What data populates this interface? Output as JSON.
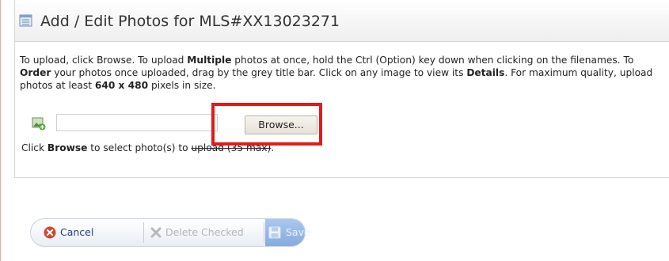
{
  "header": {
    "title": "Add / Edit Photos for MLS#XX13023271"
  },
  "instructions": {
    "p1": "To upload, click Browse. To upload ",
    "p1_bold": "Multiple",
    "p2": " photos at once, hold the Ctrl (Option) key down when clicking on the filenames. To ",
    "p2_bold": "Order",
    "p3": " your photos once uploaded, drag by the grey title bar. Click on any image to view its ",
    "p3_bold": "Details",
    "p4": ". For maximum quality, upload photos at least ",
    "p4_bold": "640 x 480",
    "p5": " pixels in size."
  },
  "upload": {
    "file_value": "",
    "browse_label": "Browse..."
  },
  "hint": {
    "pre": "Click ",
    "bold": "Browse",
    "mid": " to select photo(s) to ",
    "struck": "upload (35 max)",
    "post": "."
  },
  "toolbar": {
    "cancel_label": "Cancel",
    "delete_label": "Delete Checked",
    "save_label": "Save"
  },
  "icons": {
    "header": "photo-list-icon",
    "upload": "add-photo-icon",
    "cancel": "cancel-icon",
    "delete": "delete-icon",
    "save": "save-icon"
  },
  "colors": {
    "highlight_box": "#e11a1a",
    "cancel_text": "#1d3f8a",
    "save_bg": "#9dbde9"
  }
}
